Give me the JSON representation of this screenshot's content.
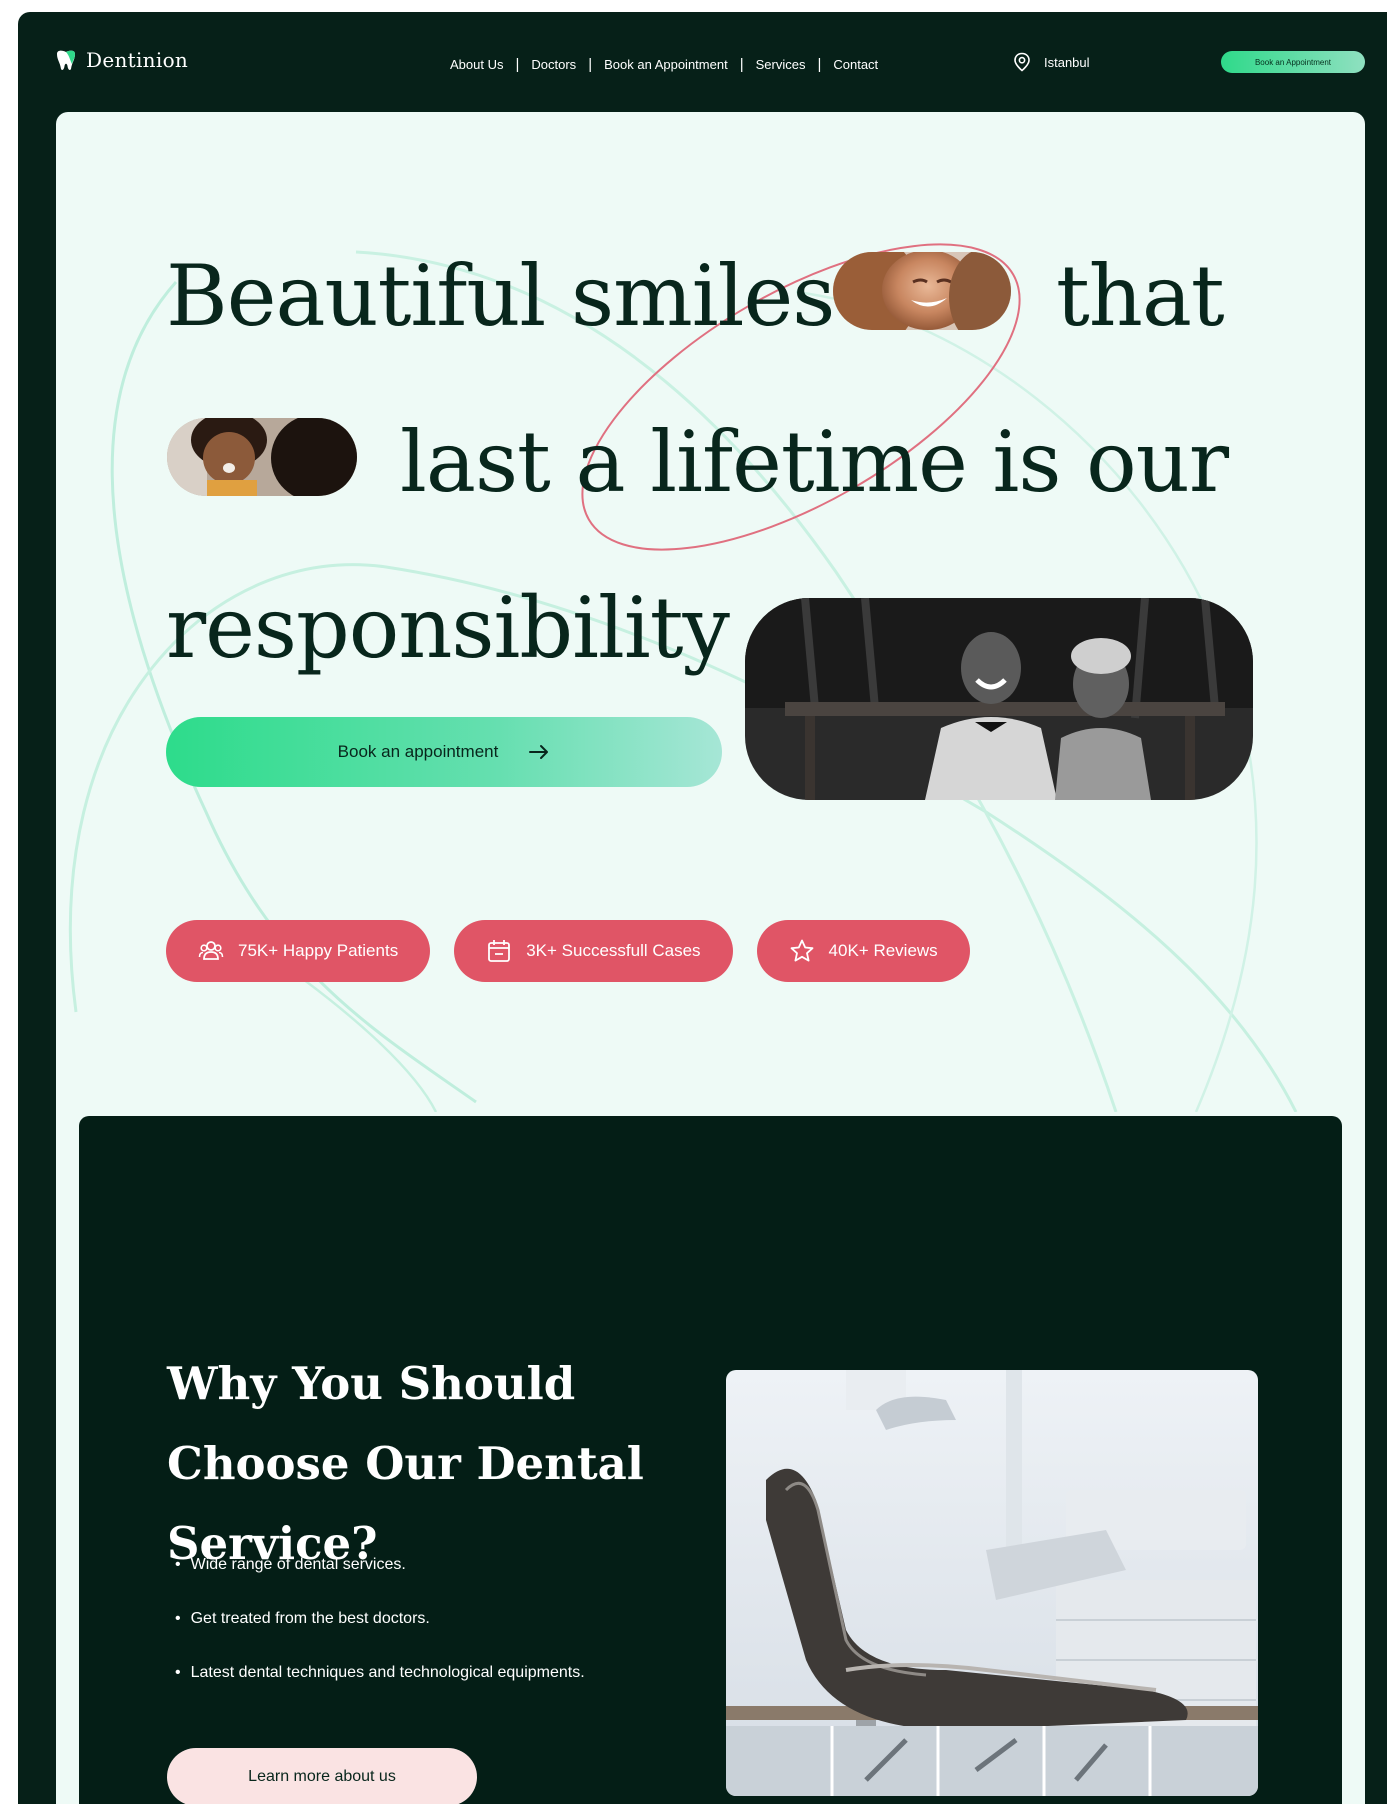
{
  "brand": {
    "name": "Dentinion"
  },
  "nav": {
    "links": [
      "About Us",
      "Doctors",
      "Book an Appointment",
      "Services",
      "Contact"
    ],
    "location": "Istanbul",
    "cta": "Book an Appointment"
  },
  "hero": {
    "line1_a": "Beautiful smiles",
    "line1_b": "that",
    "line2": "last a lifetime is our",
    "line3": "responsibility",
    "cta": "Book an appointment",
    "stats": [
      {
        "icon": "users-icon",
        "label": "75K+ Happy Patients"
      },
      {
        "icon": "calendar-icon",
        "label": "3K+ Successfull Cases"
      },
      {
        "icon": "star-icon",
        "label": "40K+ Reviews"
      }
    ]
  },
  "why": {
    "title": "Why You Should Choose Our Dental Service?",
    "points": [
      "Wide range of dental services.",
      "Get treated from the best doctors.",
      "Latest dental techniques and technological equipments."
    ],
    "cta": "Learn more about us"
  },
  "colors": {
    "dark": "#062018",
    "mint_bg": "#eefaf6",
    "accent_green": "#2ddc8b",
    "accent_red": "#e05566",
    "button_pink": "#fae3e3"
  }
}
